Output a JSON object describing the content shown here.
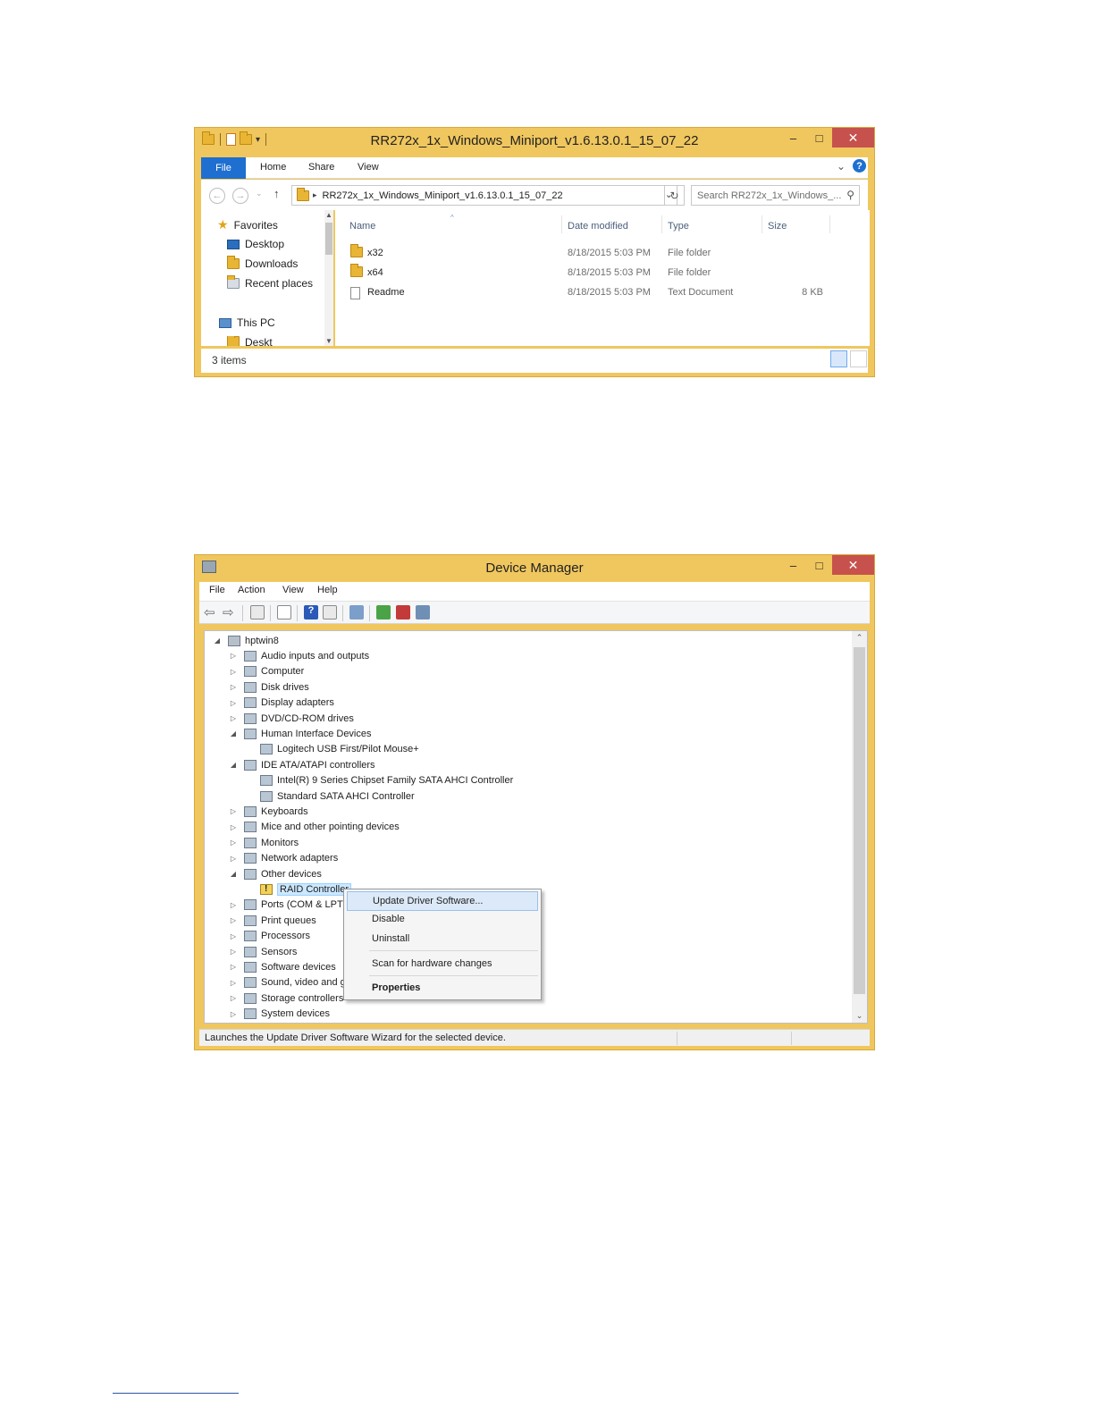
{
  "explorer": {
    "title": "RR272x_1x_Windows_Miniport_v1.6.13.0.1_15_07_22",
    "caption": {
      "minimize": "‒",
      "maximize": "□",
      "close": "✕"
    },
    "ribbon": {
      "file": "File",
      "home": "Home",
      "share": "Share",
      "view": "View",
      "expand": "⌄",
      "help": "?"
    },
    "nav": {
      "back": "←",
      "forward": "→",
      "recent": "⌄",
      "up": "↑"
    },
    "address": {
      "path": "RR272x_1x_Windows_Miniport_v1.6.13.0.1_15_07_22",
      "dropdown": "⌄",
      "refresh": "↻"
    },
    "search": {
      "placeholder": "Search RR272x_1x_Windows_...",
      "icon": "⚲"
    },
    "nav_pane": {
      "favorites": "Favorites",
      "items": [
        "Desktop",
        "Downloads",
        "Recent places"
      ],
      "this_pc": "This PC",
      "partial": "Deskt"
    },
    "columns": {
      "name": "Name",
      "date": "Date modified",
      "type": "Type",
      "size": "Size"
    },
    "files": [
      {
        "name": "x32",
        "date": "8/18/2015 5:03 PM",
        "type": "File folder",
        "size": "",
        "icon": "folder-icon"
      },
      {
        "name": "x64",
        "date": "8/18/2015 5:03 PM",
        "type": "File folder",
        "size": "",
        "icon": "folder-icon"
      },
      {
        "name": "Readme",
        "date": "8/18/2015 5:03 PM",
        "type": "Text Document",
        "size": "8 KB",
        "icon": "text-document-icon"
      }
    ],
    "status": {
      "count": "3 items"
    }
  },
  "device_manager": {
    "title": "Device Manager",
    "caption": {
      "minimize": "‒",
      "maximize": "□",
      "close": "✕"
    },
    "menu": [
      "File",
      "Action",
      "View",
      "Help"
    ],
    "tree": {
      "root": "hptwin8",
      "nodes": [
        {
          "label": "Audio inputs and outputs",
          "expanded": false
        },
        {
          "label": "Computer",
          "expanded": false
        },
        {
          "label": "Disk drives",
          "expanded": false
        },
        {
          "label": "Display adapters",
          "expanded": false
        },
        {
          "label": "DVD/CD-ROM drives",
          "expanded": false
        },
        {
          "label": "Human Interface Devices",
          "expanded": true,
          "children": [
            "Logitech USB First/Pilot Mouse+"
          ]
        },
        {
          "label": "IDE ATA/ATAPI controllers",
          "expanded": true,
          "children": [
            "Intel(R) 9 Series Chipset Family SATA AHCI Controller",
            "Standard SATA AHCI Controller"
          ]
        },
        {
          "label": "Keyboards",
          "expanded": false
        },
        {
          "label": "Mice and other pointing devices",
          "expanded": false
        },
        {
          "label": "Monitors",
          "expanded": false
        },
        {
          "label": "Network adapters",
          "expanded": false
        },
        {
          "label": "Other devices",
          "expanded": true,
          "children": [
            "RAID Controller"
          ]
        },
        {
          "label": "Ports (COM & LPT)",
          "expanded": false
        },
        {
          "label": "Print queues",
          "expanded": false
        },
        {
          "label": "Processors",
          "expanded": false
        },
        {
          "label": "Sensors",
          "expanded": false
        },
        {
          "label": "Software devices",
          "expanded": false
        },
        {
          "label": "Sound, video and game controllers",
          "expanded": false
        },
        {
          "label": "Storage controllers",
          "expanded": false
        },
        {
          "label": "System devices",
          "expanded": false
        }
      ],
      "selected": "RAID Controller"
    },
    "context_menu": {
      "items": [
        "Update Driver Software...",
        "Disable",
        "Uninstall",
        "Scan for hardware changes",
        "Properties"
      ],
      "highlighted": "Update Driver Software..."
    },
    "status": "Launches the Update Driver Software Wizard for the selected device."
  },
  "colors": {
    "frame": "#f0c75e",
    "accent": "#1e6fd0",
    "close": "#c7514c",
    "highlight": "#dce9f8"
  }
}
